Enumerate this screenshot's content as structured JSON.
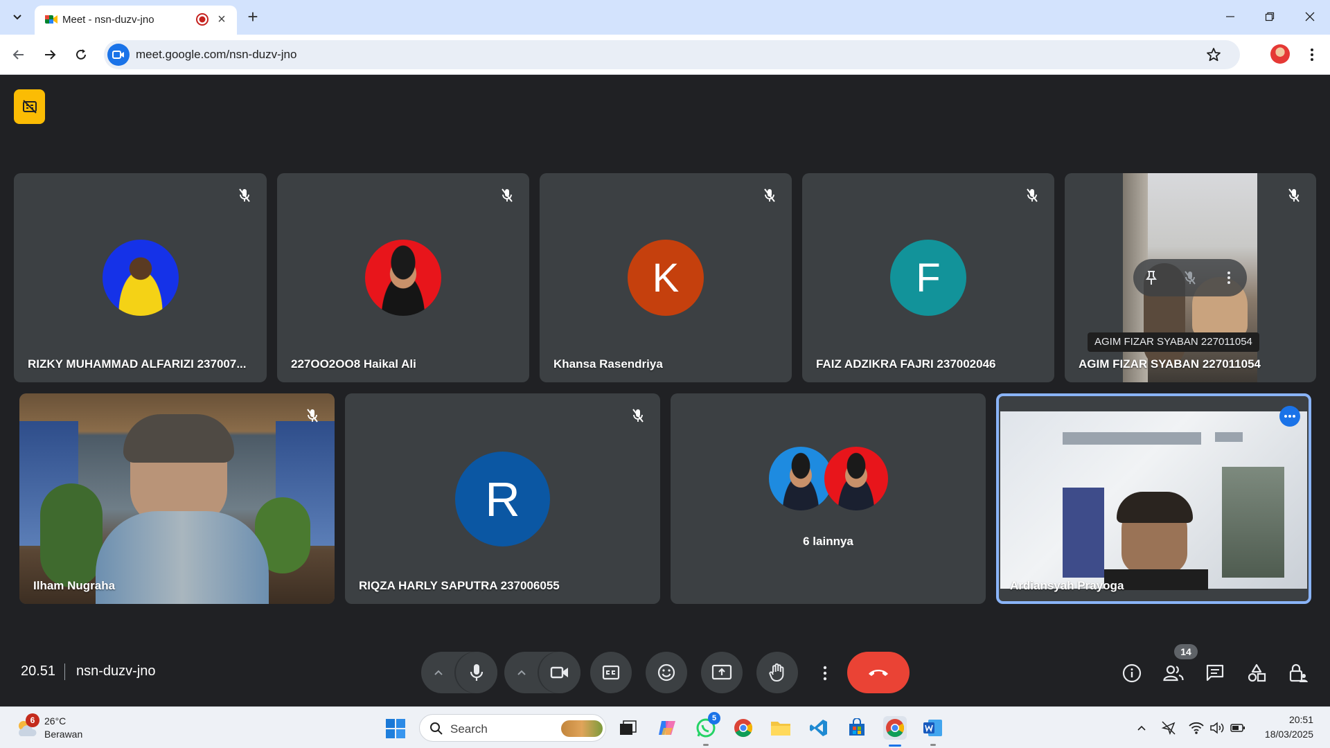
{
  "browser": {
    "tab_title": "Meet - nsn-duzv-jno",
    "close_glyph": "×",
    "new_tab_glyph": "+",
    "url": "meet.google.com/nsn-duzv-jno"
  },
  "meet": {
    "participants": [
      {
        "name": "RIZKY MUHAMMAD ALFARIZI 237007...",
        "avatar": "photo",
        "muted": true
      },
      {
        "name": "227OO2OO8 Haikal Ali",
        "avatar": "photo",
        "muted": true
      },
      {
        "name": "Khansa Rasendriya",
        "initial": "K",
        "color": "#c5400d",
        "muted": true
      },
      {
        "name": "FAIZ ADZIKRA FAJRI 237002046",
        "initial": "F",
        "color": "#12939a",
        "muted": true
      },
      {
        "name": "AGIM FIZAR SYABAN 227011054",
        "avatar": "video",
        "muted": true
      },
      {
        "name": "Ilham Nugraha",
        "avatar": "video",
        "muted": true
      },
      {
        "name": "RIQZA HARLY SAPUTRA 237006055",
        "initial": "R",
        "color": "#0b57a3",
        "muted": true
      },
      {
        "name": "6 lainnya",
        "avatar": "group"
      },
      {
        "name": "Ardiansyah Prayoga",
        "avatar": "video",
        "self": true
      }
    ],
    "tooltip": "AGIM FIZAR SYABAN 227011054",
    "time": "20.51",
    "meeting_code": "nsn-duzv-jno",
    "people_count": "14",
    "colors": {
      "background": "#202124",
      "tile": "#3c4043",
      "end_call": "#ea4335",
      "active_border": "#8ab4f8"
    }
  },
  "taskbar": {
    "weather_temp": "26°C",
    "weather_condition": "Berawan",
    "weather_badge": "6",
    "search_label": "Search",
    "whatsapp_badge": "5",
    "clock_time": "20:51",
    "clock_date": "18/03/2025"
  }
}
